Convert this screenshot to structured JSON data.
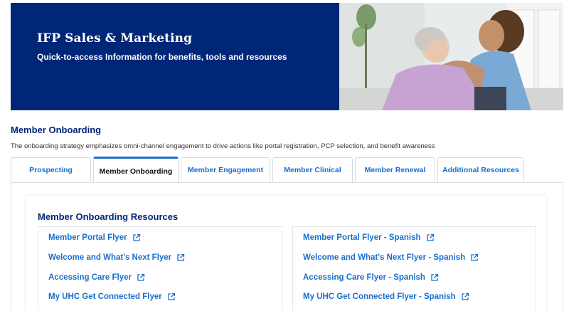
{
  "hero": {
    "title": "IFP Sales & Marketing",
    "subtitle": "Quick-to-access Information for benefits, tools and resources",
    "background_color": "#002677"
  },
  "section": {
    "title": "Member Onboarding",
    "description": "The onboarding strategy emphasizes omni-channel engagement to drive actions like portal registration, PCP selection, and benefit awareness"
  },
  "tabs": [
    {
      "label": "Prospecting",
      "active": false
    },
    {
      "label": "Member Onboarding",
      "active": true
    },
    {
      "label": "Member Engagement",
      "active": false
    },
    {
      "label": "Member Clinical",
      "active": false
    },
    {
      "label": "Member Renewal",
      "active": false
    },
    {
      "label": "Additional Resources",
      "active": false
    }
  ],
  "resources": {
    "title": "Member Onboarding Resources",
    "left_links": [
      {
        "label": "Member Portal Flyer",
        "icon": "external-link-icon"
      },
      {
        "label": "Welcome and What's Next Flyer",
        "icon": "external-link-icon"
      },
      {
        "label": "Accessing Care Flyer",
        "icon": "external-link-icon"
      },
      {
        "label": "My UHC Get Connected Flyer",
        "icon": "external-link-icon"
      }
    ],
    "right_links": [
      {
        "label": "Member Portal Flyer - Spanish",
        "icon": "external-link-icon"
      },
      {
        "label": "Welcome and What's Next Flyer - Spanish",
        "icon": "external-link-icon"
      },
      {
        "label": "Accessing Care Flyer - Spanish",
        "icon": "external-link-icon"
      },
      {
        "label": "My UHC Get Connected Flyer - Spanish",
        "icon": "external-link-icon"
      }
    ]
  },
  "colors": {
    "brand_navy": "#002677",
    "link_blue": "#196ecf"
  }
}
